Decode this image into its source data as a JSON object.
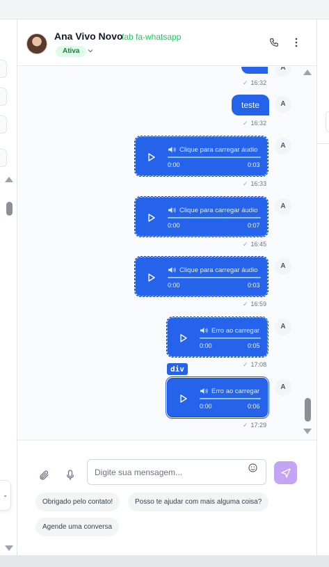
{
  "contact": {
    "name": "Ana Vivo Novo",
    "channel": "fab fa-whatsapp",
    "status": "Ativa"
  },
  "messages": [
    {
      "type": "text",
      "text": "teste",
      "time": "16:32",
      "agent": "A"
    },
    {
      "type": "audio",
      "label": "Clique para carregar áudio",
      "start": "0:00",
      "end": "0:03",
      "time": "16:33",
      "agent": "A"
    },
    {
      "type": "audio",
      "label": "Clique para carregar áudio",
      "start": "0:00",
      "end": "0:07",
      "time": "16:45",
      "agent": "A"
    },
    {
      "type": "audio",
      "label": "Clique para carregar áudio",
      "start": "0:00",
      "end": "0:03",
      "time": "16:59",
      "agent": "A"
    },
    {
      "type": "audio",
      "label": "Erro ao carregar",
      "start": "0:00",
      "end": "0:05",
      "time": "17:08",
      "agent": "A"
    },
    {
      "type": "audio",
      "label": "Erro ao carregar",
      "start": "0:00",
      "end": "0:06",
      "time": "17:29",
      "agent": "A"
    }
  ],
  "top_partial_time": "16:32",
  "inspector_tag": "div",
  "composer": {
    "placeholder": "Digite sua mensagem..."
  },
  "quick_replies": [
    "Obrigado pelo contato!",
    "Posso te ajudar com mais alguma coisa?",
    "Agende uma conversa"
  ],
  "colors": {
    "bubble": "#2563eb",
    "status_badge_bg": "#dcfce7",
    "channel_text": "#22c55e",
    "send_button": "#c4a4f5"
  },
  "icons": [
    "phone-icon",
    "more-vertical-icon",
    "chevron-down-icon",
    "play-icon",
    "speaker-icon",
    "paperclip-icon",
    "microphone-icon",
    "emoji-icon",
    "send-icon"
  ]
}
